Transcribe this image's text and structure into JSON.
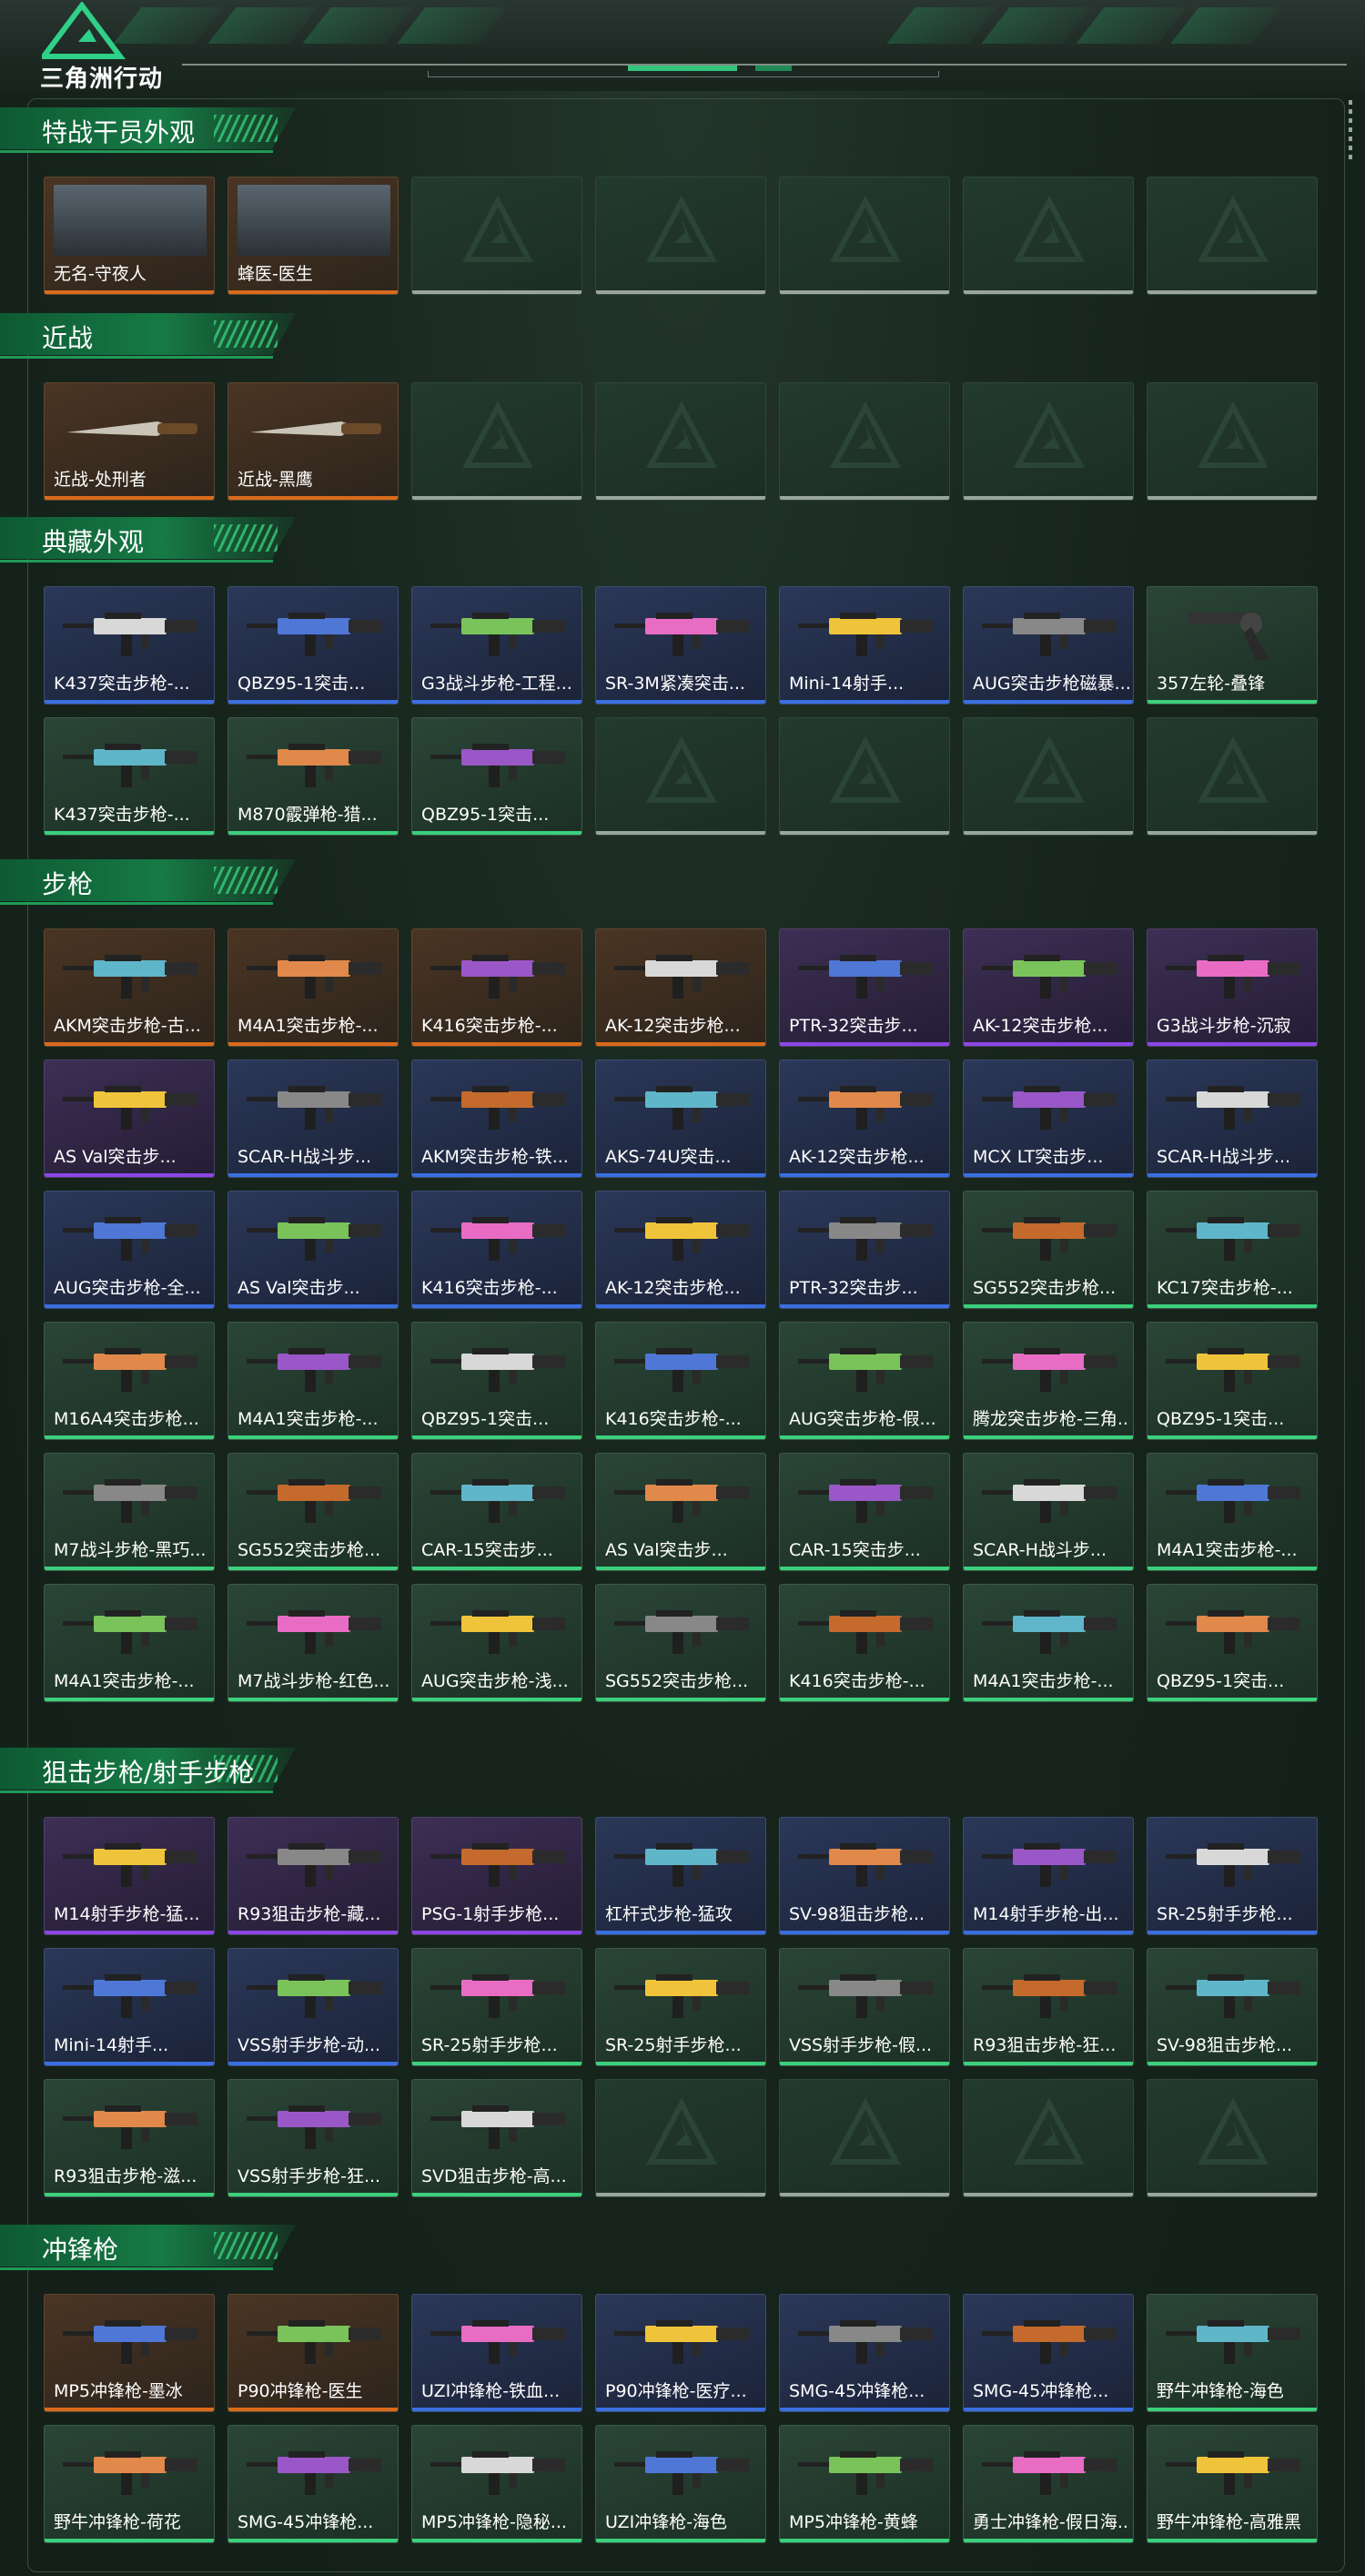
{
  "brand": {
    "logo_text": "三角洲行动"
  },
  "colors": {
    "gold": "#d96b1c",
    "purple": "#8d46e6",
    "blue": "#3a6fe0",
    "green": "#3bd07c",
    "accent": "#1f9a57"
  },
  "sections": [
    {
      "title": "特战干员外观",
      "items": [
        {
          "label": "无名-守夜人",
          "rarity": "gold",
          "kind": "operator"
        },
        {
          "label": "蜂医-医生",
          "rarity": "gold",
          "kind": "operator"
        },
        {
          "label": "",
          "rarity": "empty"
        },
        {
          "label": "",
          "rarity": "empty"
        },
        {
          "label": "",
          "rarity": "empty"
        },
        {
          "label": "",
          "rarity": "empty"
        },
        {
          "label": "",
          "rarity": "empty"
        }
      ]
    },
    {
      "title": "近战",
      "items": [
        {
          "label": "近战-处刑者",
          "rarity": "gold",
          "kind": "knife"
        },
        {
          "label": "近战-黑鹰",
          "rarity": "gold",
          "kind": "knife"
        },
        {
          "label": "",
          "rarity": "empty"
        },
        {
          "label": "",
          "rarity": "empty"
        },
        {
          "label": "",
          "rarity": "empty"
        },
        {
          "label": "",
          "rarity": "empty"
        },
        {
          "label": "",
          "rarity": "empty"
        }
      ]
    },
    {
      "title": "典藏外观",
      "items": [
        {
          "label": "K437突击步枪-...",
          "rarity": "blue"
        },
        {
          "label": "QBZ95-1突击...",
          "rarity": "blue"
        },
        {
          "label": "G3战斗步枪-工程...",
          "rarity": "blue"
        },
        {
          "label": "SR-3M紧凑突击...",
          "rarity": "blue"
        },
        {
          "label": "Mini-14射手...",
          "rarity": "blue"
        },
        {
          "label": "AUG突击步枪磁暴...",
          "rarity": "blue"
        },
        {
          "label": "357左轮-叠锋",
          "rarity": "green",
          "kind": "pistol"
        },
        {
          "label": "K437突击步枪-...",
          "rarity": "green"
        },
        {
          "label": "M870霰弹枪-猎...",
          "rarity": "green"
        },
        {
          "label": "QBZ95-1突击...",
          "rarity": "green"
        },
        {
          "label": "",
          "rarity": "empty"
        },
        {
          "label": "",
          "rarity": "empty"
        },
        {
          "label": "",
          "rarity": "empty"
        },
        {
          "label": "",
          "rarity": "empty"
        }
      ]
    },
    {
      "title": "步枪",
      "items": [
        {
          "label": "AKM突击步枪-古...",
          "rarity": "gold"
        },
        {
          "label": "M4A1突击步枪-...",
          "rarity": "gold"
        },
        {
          "label": "K416突击步枪-...",
          "rarity": "gold"
        },
        {
          "label": "AK-12突击步枪...",
          "rarity": "gold"
        },
        {
          "label": "PTR-32突击步...",
          "rarity": "purple"
        },
        {
          "label": "AK-12突击步枪...",
          "rarity": "purple"
        },
        {
          "label": "G3战斗步枪-沉寂",
          "rarity": "purple"
        },
        {
          "label": "AS Val突击步...",
          "rarity": "purple"
        },
        {
          "label": "SCAR-H战斗步...",
          "rarity": "blue"
        },
        {
          "label": "AKM突击步枪-铁...",
          "rarity": "blue"
        },
        {
          "label": "AKS-74U突击...",
          "rarity": "blue"
        },
        {
          "label": "AK-12突击步枪...",
          "rarity": "blue"
        },
        {
          "label": "MCX LT突击步...",
          "rarity": "blue"
        },
        {
          "label": "SCAR-H战斗步...",
          "rarity": "blue"
        },
        {
          "label": "AUG突击步枪-全...",
          "rarity": "blue"
        },
        {
          "label": "AS Val突击步...",
          "rarity": "blue"
        },
        {
          "label": "K416突击步枪-...",
          "rarity": "blue"
        },
        {
          "label": "AK-12突击步枪...",
          "rarity": "blue"
        },
        {
          "label": "PTR-32突击步...",
          "rarity": "blue"
        },
        {
          "label": "SG552突击步枪...",
          "rarity": "green"
        },
        {
          "label": "KC17突击步枪-...",
          "rarity": "green"
        },
        {
          "label": "M16A4突击步枪...",
          "rarity": "green"
        },
        {
          "label": "M4A1突击步枪-...",
          "rarity": "green"
        },
        {
          "label": "QBZ95-1突击...",
          "rarity": "green"
        },
        {
          "label": "K416突击步枪-...",
          "rarity": "green"
        },
        {
          "label": "AUG突击步枪-假...",
          "rarity": "green"
        },
        {
          "label": "腾龙突击步枪-三角...",
          "rarity": "green"
        },
        {
          "label": "QBZ95-1突击...",
          "rarity": "green"
        },
        {
          "label": "M7战斗步枪-黑巧...",
          "rarity": "green"
        },
        {
          "label": "SG552突击步枪...",
          "rarity": "green"
        },
        {
          "label": "CAR-15突击步...",
          "rarity": "green"
        },
        {
          "label": "AS Val突击步...",
          "rarity": "green"
        },
        {
          "label": "CAR-15突击步...",
          "rarity": "green"
        },
        {
          "label": "SCAR-H战斗步...",
          "rarity": "green"
        },
        {
          "label": "M4A1突击步枪-...",
          "rarity": "green"
        },
        {
          "label": "M4A1突击步枪-...",
          "rarity": "green"
        },
        {
          "label": "M7战斗步枪-红色...",
          "rarity": "green"
        },
        {
          "label": "AUG突击步枪-浅...",
          "rarity": "green"
        },
        {
          "label": "SG552突击步枪...",
          "rarity": "green"
        },
        {
          "label": "K416突击步枪-...",
          "rarity": "green"
        },
        {
          "label": "M4A1突击步枪-...",
          "rarity": "green"
        },
        {
          "label": "QBZ95-1突击...",
          "rarity": "green"
        }
      ]
    },
    {
      "title": "狙击步枪/射手步枪",
      "items": [
        {
          "label": "M14射手步枪-猛...",
          "rarity": "purple"
        },
        {
          "label": "R93狙击步枪-藏...",
          "rarity": "purple"
        },
        {
          "label": "PSG-1射手步枪...",
          "rarity": "purple"
        },
        {
          "label": "杠杆式步枪-猛攻",
          "rarity": "blue"
        },
        {
          "label": "SV-98狙击步枪...",
          "rarity": "blue"
        },
        {
          "label": "M14射手步枪-出...",
          "rarity": "blue"
        },
        {
          "label": "SR-25射手步枪...",
          "rarity": "blue"
        },
        {
          "label": "Mini-14射手...",
          "rarity": "blue"
        },
        {
          "label": "VSS射手步枪-动...",
          "rarity": "blue"
        },
        {
          "label": "SR-25射手步枪...",
          "rarity": "green"
        },
        {
          "label": "SR-25射手步枪...",
          "rarity": "green"
        },
        {
          "label": "VSS射手步枪-假...",
          "rarity": "green"
        },
        {
          "label": "R93狙击步枪-狂...",
          "rarity": "green"
        },
        {
          "label": "SV-98狙击步枪...",
          "rarity": "green"
        },
        {
          "label": "R93狙击步枪-滋...",
          "rarity": "green"
        },
        {
          "label": "VSS射手步枪-狂...",
          "rarity": "green"
        },
        {
          "label": "SVD狙击步枪-高...",
          "rarity": "green"
        },
        {
          "label": "",
          "rarity": "empty"
        },
        {
          "label": "",
          "rarity": "empty"
        },
        {
          "label": "",
          "rarity": "empty"
        },
        {
          "label": "",
          "rarity": "empty"
        }
      ]
    },
    {
      "title": "冲锋枪",
      "items": [
        {
          "label": "MP5冲锋枪-墨冰",
          "rarity": "gold"
        },
        {
          "label": "P90冲锋枪-医生",
          "rarity": "gold"
        },
        {
          "label": "UZI冲锋枪-铁血...",
          "rarity": "blue"
        },
        {
          "label": "P90冲锋枪-医疗...",
          "rarity": "blue"
        },
        {
          "label": "SMG-45冲锋枪...",
          "rarity": "blue"
        },
        {
          "label": "SMG-45冲锋枪...",
          "rarity": "blue"
        },
        {
          "label": "野牛冲锋枪-海色",
          "rarity": "green"
        },
        {
          "label": "野牛冲锋枪-荷花",
          "rarity": "green"
        },
        {
          "label": "SMG-45冲锋枪...",
          "rarity": "green"
        },
        {
          "label": "MP5冲锋枪-隐秘...",
          "rarity": "green"
        },
        {
          "label": "UZI冲锋枪-海色",
          "rarity": "green"
        },
        {
          "label": "MP5冲锋枪-黄蜂",
          "rarity": "green"
        },
        {
          "label": "勇士冲锋枪-假日海...",
          "rarity": "green"
        },
        {
          "label": "野牛冲锋枪-高雅黑",
          "rarity": "green"
        }
      ]
    }
  ]
}
